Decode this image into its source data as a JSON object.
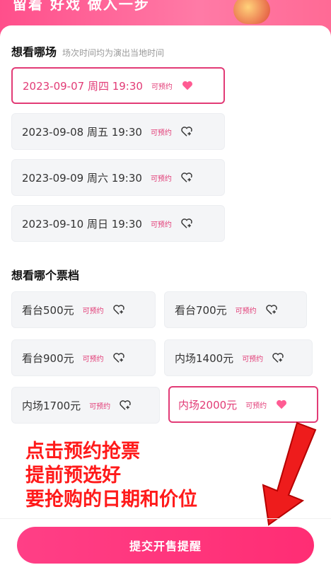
{
  "banner": {
    "text": "留着 好戏 做入一步"
  },
  "colors": {
    "accent": "#e23b76",
    "overlay_text": "#ff1a1a",
    "button": "#ff3f86"
  },
  "date_section": {
    "title": "想看哪场",
    "subtitle": "场次时间均为演出当地时间",
    "options": [
      {
        "label": "2023-09-07 周四 19:30",
        "badge": "可预约",
        "selected": true,
        "icon": "heart-filled-icon"
      },
      {
        "label": "2023-09-08 周五 19:30",
        "badge": "可预约",
        "selected": false,
        "icon": "heart-plus-icon"
      },
      {
        "label": "2023-09-09 周六 19:30",
        "badge": "可预约",
        "selected": false,
        "icon": "heart-plus-icon"
      },
      {
        "label": "2023-09-10 周日 19:30",
        "badge": "可预约",
        "selected": false,
        "icon": "heart-plus-icon"
      }
    ]
  },
  "price_section": {
    "title": "想看哪个票档",
    "options": [
      {
        "label": "看台500元",
        "badge": "可预约",
        "selected": false,
        "icon": "heart-plus-icon"
      },
      {
        "label": "看台700元",
        "badge": "可预约",
        "selected": false,
        "icon": "heart-plus-icon"
      },
      {
        "label": "看台900元",
        "badge": "可预约",
        "selected": false,
        "icon": "heart-plus-icon"
      },
      {
        "label": "内场1400元",
        "badge": "可预约",
        "selected": false,
        "icon": "heart-plus-icon"
      },
      {
        "label": "内场1700元",
        "badge": "可预约",
        "selected": false,
        "icon": "heart-plus-icon"
      },
      {
        "label": "内场2000元",
        "badge": "可预约",
        "selected": true,
        "icon": "heart-filled-icon"
      }
    ]
  },
  "overlay": {
    "lines": [
      "点击预约抢票",
      "提前预选好",
      "要抢购的日期和价位"
    ]
  },
  "footer": {
    "submit_label": "提交开售提醒"
  }
}
